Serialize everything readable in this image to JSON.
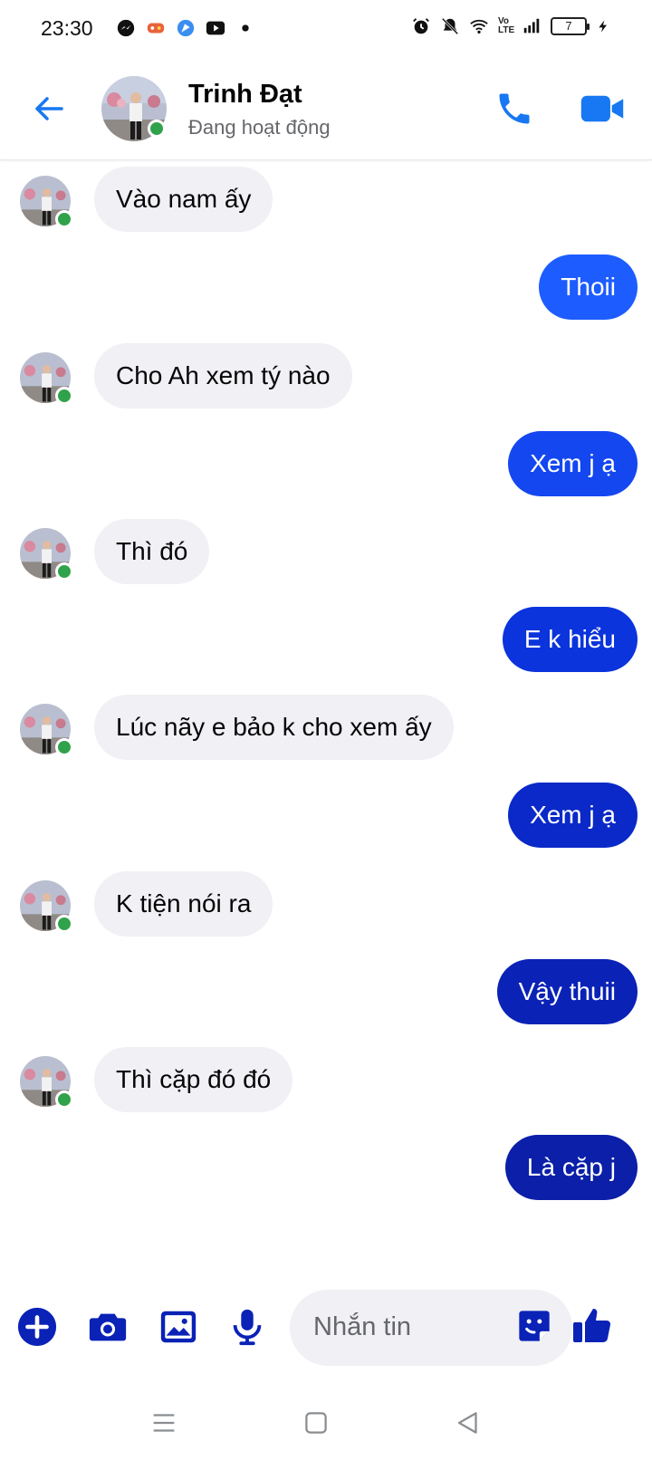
{
  "status_bar": {
    "time": "23:30",
    "left_icons": [
      "messenger-icon",
      "game-icon",
      "browser-icon",
      "youtube-icon",
      "dot-icon"
    ],
    "right_icons": [
      "alarm-icon",
      "mute-icon",
      "wifi-icon",
      "volte-icon",
      "signal-icon",
      "battery-icon",
      "charging-icon"
    ],
    "volte": "Vo LTE",
    "battery": "7"
  },
  "header": {
    "name": "Trinh Đạt",
    "status": "Đang hoạt động",
    "online_color": "#31a24c"
  },
  "messages": [
    {
      "from": "them",
      "text": "Vào nam ấy"
    },
    {
      "from": "me",
      "text": "Thoii",
      "color": "#1d5cff"
    },
    {
      "from": "them",
      "text": "Cho Ah xem tý nào"
    },
    {
      "from": "me",
      "text": "Xem j ạ",
      "color": "#1447ef"
    },
    {
      "from": "them",
      "text": "Thì đó"
    },
    {
      "from": "me",
      "text": "E k hiểu",
      "color": "#0b34dc"
    },
    {
      "from": "them",
      "text": "Lúc nãy e bảo k cho xem ấy"
    },
    {
      "from": "me",
      "text": "Xem j ạ",
      "color": "#0a29c8"
    },
    {
      "from": "them",
      "text": "K tiện nói ra"
    },
    {
      "from": "me",
      "text": "Vậy thuii",
      "color": "#0a22b6"
    },
    {
      "from": "them",
      "text": "Thì cặp đó đó"
    },
    {
      "from": "me",
      "text": "Là cặp j",
      "color": "#0b1fa8"
    }
  ],
  "composer": {
    "placeholder": "Nhắn tin",
    "accent": "#0a22b6"
  },
  "navbar": {
    "buttons": [
      "menu-button",
      "home-button",
      "back-button"
    ]
  }
}
